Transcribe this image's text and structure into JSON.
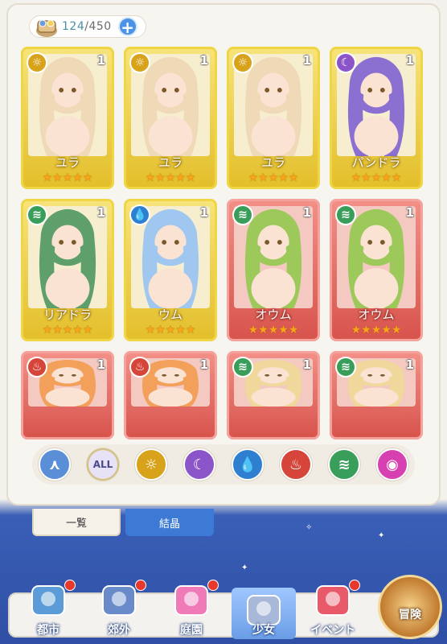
{
  "currency": {
    "current": "124",
    "separator": "/",
    "max": "450",
    "add_label": "+"
  },
  "cards": [
    {
      "name": "ユラ",
      "count": "1",
      "frame": "gold",
      "element": "sun",
      "elem_color": "#d9a21b",
      "elem_glyph": "☼",
      "stars": "★★★★★",
      "hair": "#efd9b7"
    },
    {
      "name": "ユラ",
      "count": "1",
      "frame": "gold",
      "element": "sun",
      "elem_color": "#d9a21b",
      "elem_glyph": "☼",
      "stars": "★★★★★",
      "hair": "#efd9b7"
    },
    {
      "name": "ユラ",
      "count": "1",
      "frame": "gold",
      "element": "sun",
      "elem_color": "#d9a21b",
      "elem_glyph": "☼",
      "stars": "★★★★★",
      "hair": "#efd9b7"
    },
    {
      "name": "パンドラ",
      "count": "1",
      "frame": "gold",
      "element": "moon",
      "elem_color": "#8b54c9",
      "elem_glyph": "☾",
      "stars": "★★★★★",
      "hair": "#8b6fd1"
    },
    {
      "name": "リアドラ",
      "count": "1",
      "frame": "gold",
      "element": "wind",
      "elem_color": "#3a9e5b",
      "elem_glyph": "≋",
      "stars": "★★★★★",
      "hair": "#5e9f6c"
    },
    {
      "name": "ウム",
      "count": "1",
      "frame": "gold",
      "element": "water",
      "elem_color": "#2f7fd0",
      "elem_glyph": "💧",
      "stars": "★★★★★",
      "hair": "#9fc7f0"
    },
    {
      "name": "オウム",
      "count": "1",
      "frame": "red",
      "element": "wind",
      "elem_color": "#3a9e5b",
      "elem_glyph": "≋",
      "stars": "★★★★★",
      "hair": "#9cc95a"
    },
    {
      "name": "オウム",
      "count": "1",
      "frame": "red",
      "element": "wind",
      "elem_color": "#3a9e5b",
      "elem_glyph": "≋",
      "stars": "★★★★★",
      "hair": "#9cc95a"
    },
    {
      "name": "",
      "count": "1",
      "frame": "red",
      "element": "fire",
      "elem_color": "#d6453a",
      "elem_glyph": "♨",
      "stars": "",
      "hair": "#f2a05a"
    },
    {
      "name": "",
      "count": "1",
      "frame": "red",
      "element": "fire",
      "elem_color": "#d6453a",
      "elem_glyph": "♨",
      "stars": "",
      "hair": "#f2a05a"
    },
    {
      "name": "",
      "count": "1",
      "frame": "red",
      "element": "wind",
      "elem_color": "#3a9e5b",
      "elem_glyph": "≋",
      "stars": "",
      "hair": "#f0d79b"
    },
    {
      "name": "",
      "count": "1",
      "frame": "red",
      "element": "wind",
      "elem_color": "#3a9e5b",
      "elem_glyph": "≋",
      "stars": "",
      "hair": "#f0d79b"
    }
  ],
  "filters": [
    {
      "id": "sort",
      "label": "",
      "color": "#5a8fd8",
      "glyph": "⋏"
    },
    {
      "id": "all",
      "label": "ALL",
      "color": "#e7e2f5",
      "glyph": ""
    },
    {
      "id": "sun",
      "label": "",
      "color": "#d9a21b",
      "glyph": "☼"
    },
    {
      "id": "moon",
      "label": "",
      "color": "#8b54c9",
      "glyph": "☾"
    },
    {
      "id": "water",
      "label": "",
      "color": "#2f7fd0",
      "glyph": "💧"
    },
    {
      "id": "fire",
      "label": "",
      "color": "#d6453a",
      "glyph": "♨"
    },
    {
      "id": "wind",
      "label": "",
      "color": "#3a9e5b",
      "glyph": "≋"
    },
    {
      "id": "special",
      "label": "",
      "color": "#d640b0",
      "glyph": "◉"
    }
  ],
  "subtabs": {
    "list": "一覧",
    "crystal": "結晶"
  },
  "nav": [
    {
      "id": "city",
      "label": "都市",
      "badge": true,
      "color": "#5a9bd8"
    },
    {
      "id": "outskirts",
      "label": "郊外",
      "badge": true,
      "color": "#6a8bc9"
    },
    {
      "id": "garden",
      "label": "庭園",
      "badge": true,
      "color": "#f07ab8"
    },
    {
      "id": "girl",
      "label": "少女",
      "badge": false,
      "color": "#a8b8d8"
    },
    {
      "id": "event",
      "label": "イベント",
      "badge": true,
      "color": "#e85a6a"
    },
    {
      "id": "adventure",
      "label": "冒険",
      "badge": false,
      "color": "#c07a2e"
    }
  ]
}
